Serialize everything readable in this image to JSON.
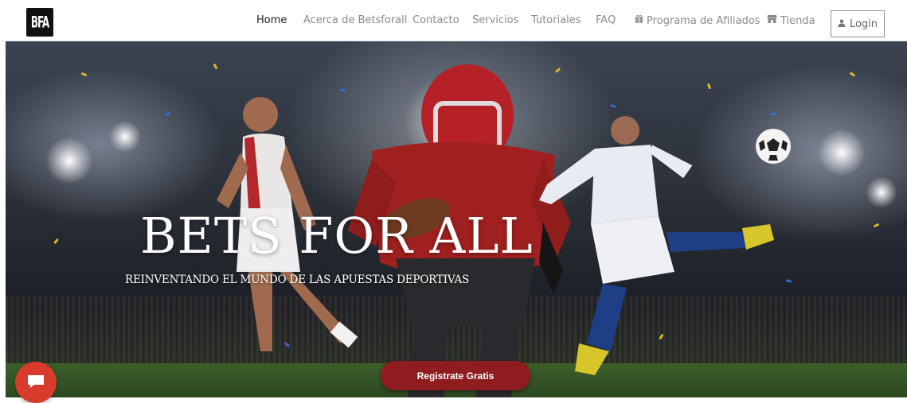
{
  "header": {
    "logo_text": "BFA",
    "nav": [
      {
        "label": "Home",
        "active": true
      },
      {
        "label": "Acerca de Betsforall"
      },
      {
        "label": "Contacto"
      },
      {
        "label": "Servicios"
      },
      {
        "label": "Tutoriales"
      },
      {
        "label": "FAQ"
      },
      {
        "label": "Programa de Afiliados",
        "icon": "gift-icon"
      },
      {
        "label": "Tienda",
        "icon": "store-icon"
      }
    ],
    "login_label": "Login",
    "login_icon": "user-icon"
  },
  "hero": {
    "title": "BETS FOR ALL",
    "subtitle": "REINVENTANDO EL MUNDO DE LAS APUESTAS DEPORTIVAS",
    "cta_label": "Registrate Gratis",
    "cta_color": "#8f1d20"
  },
  "chat": {
    "icon": "chat-icon",
    "color": "#d83b2b"
  }
}
